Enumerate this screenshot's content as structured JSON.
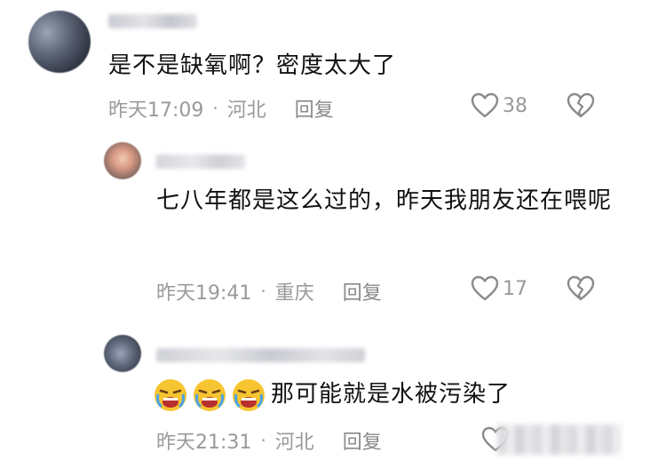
{
  "comments": [
    {
      "text": "是不是缺氧啊？密度太大了",
      "time": "昨天17:09",
      "location": "河北",
      "reply_label": "回复",
      "likes": "38"
    },
    {
      "text": "七八年都是这么过的，昨天我朋友还在喂呢",
      "time": "昨天19:41",
      "location": "重庆",
      "reply_label": "回复",
      "likes": "17"
    },
    {
      "text": "那可能就是水被污染了",
      "time": "昨天21:31",
      "location": "河北",
      "reply_label": "回复",
      "emoji_count": 3
    }
  ],
  "meta_separator": "·",
  "icons": {
    "like": "heart-outline-icon",
    "dislike": "broken-heart-icon",
    "emoji": "crying-face-emoji"
  },
  "colors": {
    "text": "#111111",
    "meta": "#9a9a9a",
    "background": "#ffffff"
  }
}
